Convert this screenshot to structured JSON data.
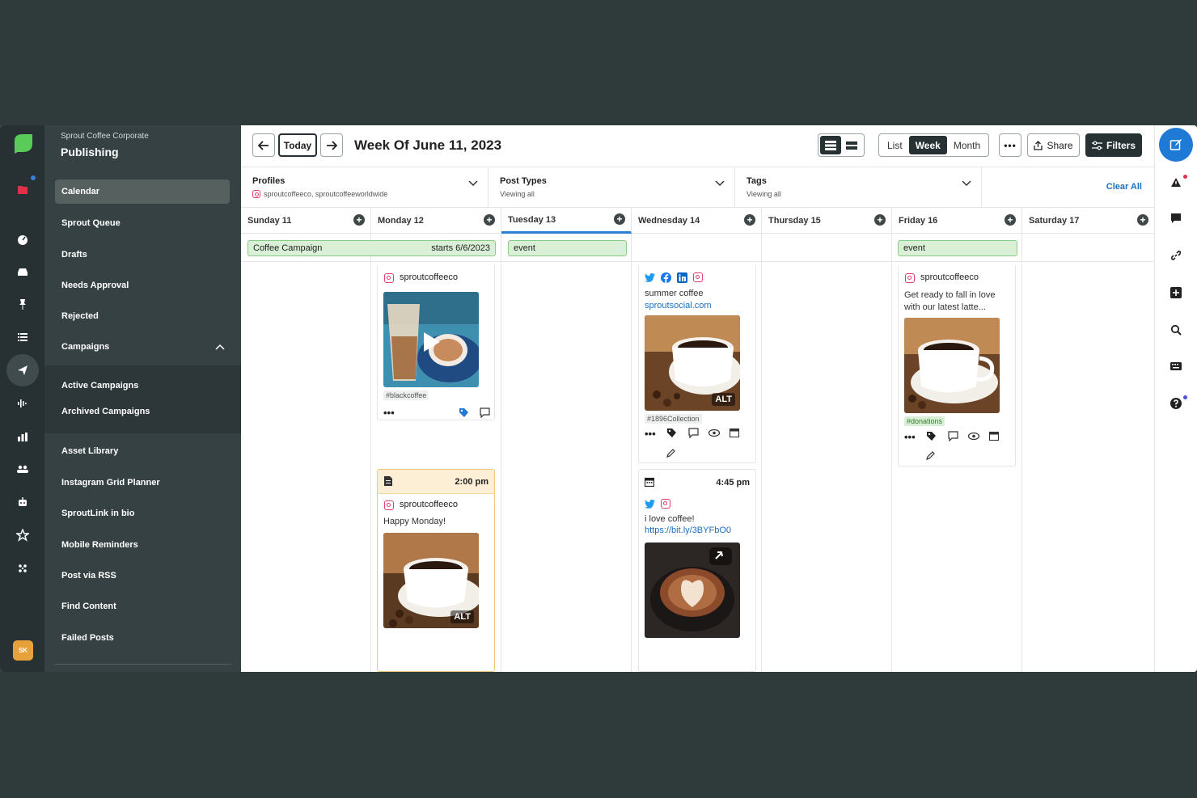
{
  "nav": {
    "org": "Sprout Coffee Corporate",
    "section": "Publishing",
    "items": [
      "Calendar",
      "Sprout Queue",
      "Drafts",
      "Needs Approval",
      "Rejected",
      "Campaigns"
    ],
    "campaign_sub": [
      "Active Campaigns",
      "Archived Campaigns"
    ],
    "items2": [
      "Asset Library",
      "Instagram Grid Planner",
      "SproutLink in bio",
      "Mobile Reminders",
      "Post via RSS",
      "Find Content",
      "Failed Posts"
    ],
    "avatar": "SK"
  },
  "toolbar": {
    "today": "Today",
    "title": "Week Of June 11, 2023",
    "views": [
      "List",
      "Week",
      "Month"
    ],
    "active_view": "Week",
    "share": "Share",
    "filters": "Filters"
  },
  "filters": {
    "profiles_label": "Profiles",
    "profiles_value": "sproutcoffeeco, sproutcoffeeworldwide",
    "types_label": "Post Types",
    "types_value": "Viewing all",
    "tags_label": "Tags",
    "tags_value": "Viewing all",
    "clear": "Clear All"
  },
  "days": [
    "Sunday 11",
    "Monday 12",
    "Tuesday 13",
    "Wednesday 14",
    "Thursday 15",
    "Friday 16",
    "Saturday 17"
  ],
  "current_day": "Tuesday 13",
  "events": {
    "campaign_name": "Coffee Campaign",
    "campaign_start": "starts 6/6/2023",
    "tue_event": "event",
    "fri_event": "event"
  },
  "posts": {
    "mon1": {
      "account": "sproutcoffeeco",
      "tag": "#blackcoffee"
    },
    "mon2": {
      "time": "2:00 pm",
      "account": "sproutcoffeeco",
      "text": "Happy Monday!",
      "alt": "ALT"
    },
    "wed1": {
      "text": "summer coffee",
      "link": "sproutsocial.com",
      "tag": "#1896Collection",
      "alt": "ALT"
    },
    "wed2": {
      "time": "4:45 pm",
      "text": "i love coffee!",
      "link": "https://bit.ly/3BYFbO0"
    },
    "fri1": {
      "account": "sproutcoffeeco",
      "text": "Get ready to fall in love with our latest latte...",
      "tag": "#donations"
    }
  },
  "colors": {
    "accent": "#1f7ad6",
    "dark": "#273133",
    "campaign_green": "#d9f0d6"
  }
}
